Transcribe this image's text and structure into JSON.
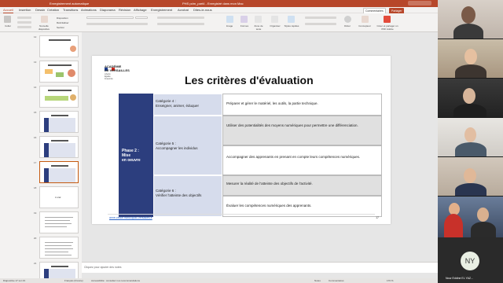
{
  "window": {
    "left_title": "Enregistrement automatique",
    "center_title": "PHS pdm_part4 - Enregistré dans mon Mac"
  },
  "ribbon_tabs": [
    "Accueil",
    "Insertion",
    "Dessin",
    "Création",
    "Transitions",
    "Animations",
    "Diaporama",
    "Révision",
    "Affichage",
    "Enregistrement",
    "Acrobat",
    "Dites-le-nous"
  ],
  "ribbon_buttons": {
    "comments": "Commentaires",
    "share": "Partager"
  },
  "ribbon_groups": [
    "Coller",
    "Nouvelle diapositive",
    "Disposition",
    "Réinitialiser",
    "Section",
    "Image",
    "Formes",
    "Zone de texte",
    "Organiser",
    "Styles rapides",
    "Dicter",
    "Concepteur",
    "Créer et partager un PDF Adobe"
  ],
  "thumbnails": [
    {
      "num": "12",
      "label": ""
    },
    {
      "num": "13",
      "label": ""
    },
    {
      "num": "14",
      "label": ""
    },
    {
      "num": "15",
      "label": ""
    },
    {
      "num": "16",
      "label": ""
    },
    {
      "num": "17",
      "label": ""
    },
    {
      "num": "18",
      "label": "L'oral"
    },
    {
      "num": "19",
      "label": ""
    },
    {
      "num": "20",
      "label": ""
    },
    {
      "num": "21",
      "label": ""
    }
  ],
  "slide": {
    "logo_line1": "ACADÉMIE",
    "logo_line2": "DE VERSAILLES",
    "logo_sub1": "Liberté",
    "logo_sub2": "Égalité",
    "logo_sub3": "Fraternité",
    "title": "Les critères d'évaluation",
    "phase_label_1": "Phase 2 :",
    "phase_label_2": "Mise",
    "phase_label_3": "en oeuvre",
    "rows": [
      {
        "category_1": "Catégorie 4 :",
        "category_2": "Enseigner, animer, éduquer",
        "desc": "Préparer et gérer le matériel, les outils, la partie technique."
      },
      {
        "category_1": "Catégorie 5 :",
        "category_2": "Accompagner les individus",
        "desc": "Utiliser des potentialités des moyens numériques pour permettre une différenciation."
      },
      {
        "category_1": "",
        "category_2": "",
        "desc": "Accompagner des apprenants en prenant en compte leurs compétences numériques."
      },
      {
        "category_1": "Catégorie 6 :",
        "category_2": "Vérifier l'atteinte des objectifs",
        "desc": "Mesurer la réalité de l'atteinte des objectifs de l'activité."
      },
      {
        "category_1": "",
        "category_2": "",
        "desc": "Évaluer les compétences numériques des apprenants."
      }
    ],
    "email": "anne-cecile.franco@ac-versailles.fr",
    "page_number": "17"
  },
  "notes_placeholder": "Cliquez pour ajouter des notes",
  "status": {
    "slide_info": "Diapositive 17 sur 23",
    "language": "Français (France)",
    "accessibility": "Accessibilité : consultez nos recommandations",
    "notes": "Notes",
    "comments": "Commentaires",
    "zoom": "176 %"
  },
  "participants": {
    "avatar_initials": "NY",
    "avatar_name": "Nour Eddine EL YAZ..."
  },
  "colors": {
    "ppt_brand": "#b7472a",
    "table_phase": "#2c3e7e",
    "table_category": "#d6dcec",
    "selected_thumb": "#c55a11"
  }
}
